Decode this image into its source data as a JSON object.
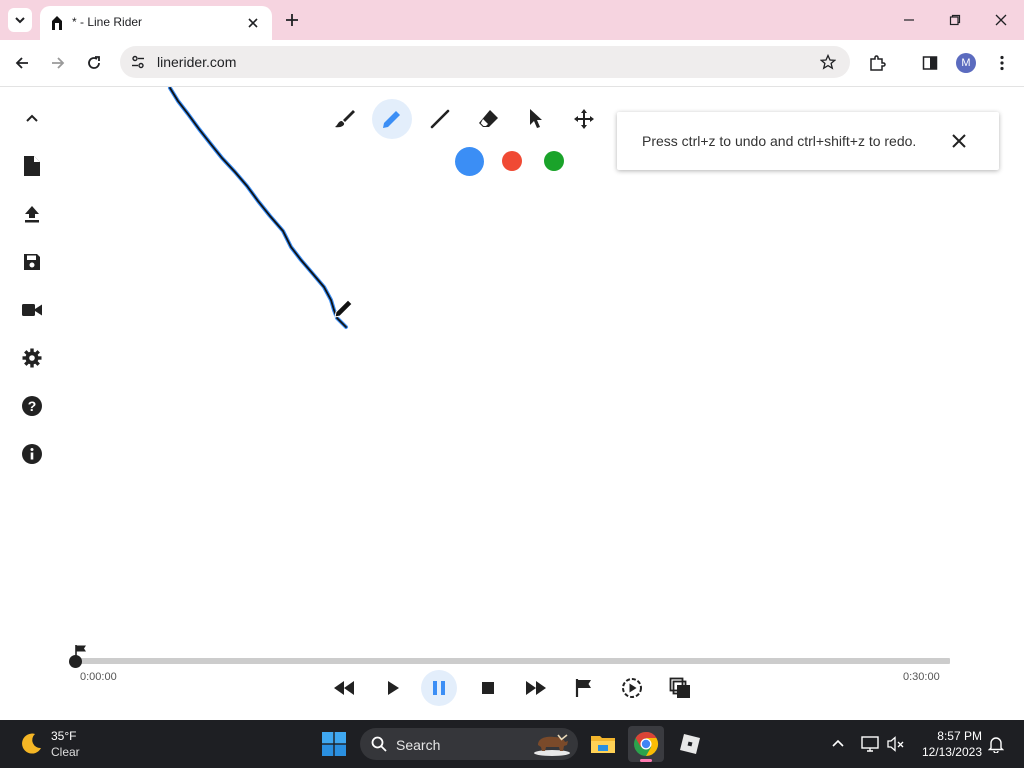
{
  "browser": {
    "tab": {
      "title": "* - Line Rider"
    },
    "omnibox": {
      "url": "linerider.com"
    },
    "profile_initial": "M"
  },
  "app": {
    "side_menu": [
      {
        "icon": "collapse-up-icon"
      },
      {
        "icon": "new-track-icon"
      },
      {
        "icon": "load-track-icon"
      },
      {
        "icon": "save-track-icon"
      },
      {
        "icon": "record-video-icon"
      },
      {
        "icon": "settings-icon"
      },
      {
        "icon": "help-icon"
      },
      {
        "icon": "info-icon"
      }
    ],
    "tools": [
      {
        "icon": "brush-icon",
        "active": false
      },
      {
        "icon": "pencil-icon",
        "active": true
      },
      {
        "icon": "line-icon",
        "active": false
      },
      {
        "icon": "eraser-icon",
        "active": false
      },
      {
        "icon": "select-icon",
        "active": false
      },
      {
        "icon": "pan-icon",
        "active": false
      }
    ],
    "line_colors": [
      {
        "name": "blue",
        "color": "#3b8ef5",
        "selected": true
      },
      {
        "name": "red",
        "color": "#f04a34"
      },
      {
        "name": "green",
        "color": "#1aa32a"
      }
    ],
    "toast": {
      "message": "Press ctrl+z to undo and ctrl+shift+z to redo."
    },
    "timeline": {
      "start_time": "0:00:00",
      "end_time": "0:30:00",
      "position_fraction": 0.0
    },
    "playback": [
      {
        "icon": "rewind-icon"
      },
      {
        "icon": "play-icon"
      },
      {
        "icon": "pause-icon",
        "active": true
      },
      {
        "icon": "stop-icon"
      },
      {
        "icon": "fast-forward-icon"
      },
      {
        "icon": "flag-icon"
      },
      {
        "icon": "slow-motion-icon"
      },
      {
        "icon": "onion-skin-icon"
      }
    ]
  },
  "taskbar": {
    "weather": {
      "temperature": "35°F",
      "condition": "Clear"
    },
    "search_label": "Search",
    "time": "8:57 PM",
    "date": "12/13/2023"
  }
}
